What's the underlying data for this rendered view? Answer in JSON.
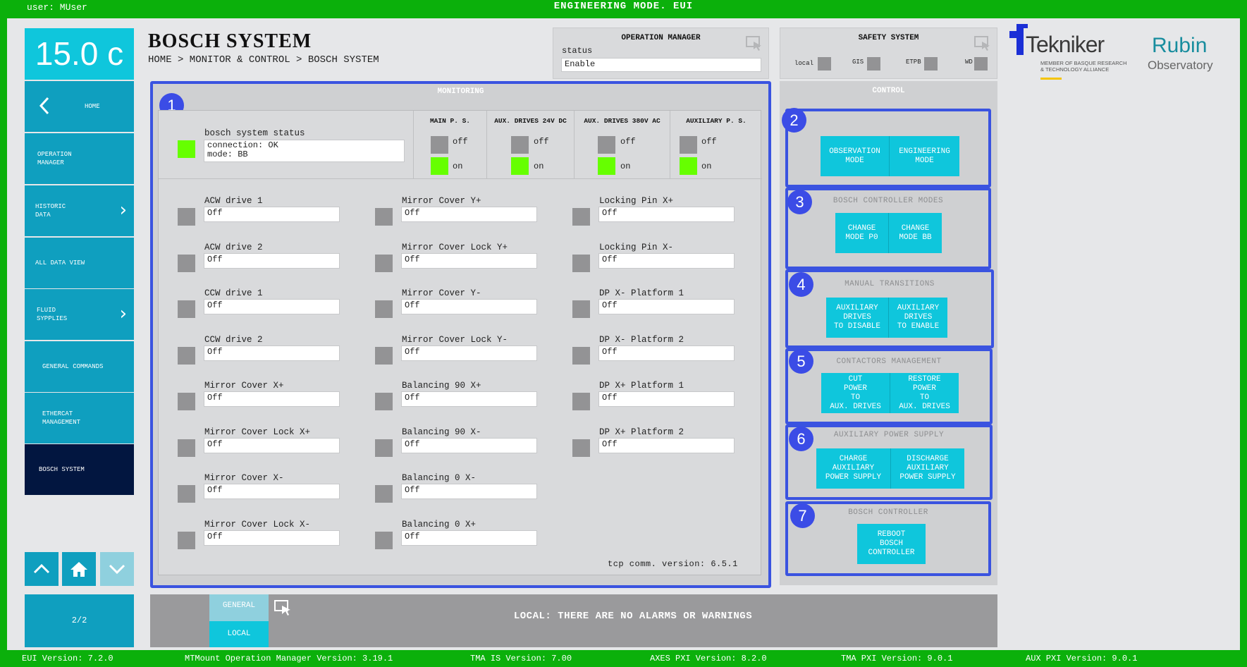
{
  "topbar": {
    "user": "user: MUser",
    "mode": "ENGINEERING MODE. EUI"
  },
  "temperature": "15.0 c",
  "nav": {
    "home": "HOME",
    "operation_manager": "OPERATION\nMANAGER",
    "historic_data": "HISTORIC\nDATA",
    "all_data_view": "ALL DATA VIEW",
    "fluid_supplies": "FLUID\nSYPPLIES",
    "general_commands": "GENERAL COMMANDS",
    "ethercat": "ETHERCAT\nMANAGEMENT",
    "bosch_system": "BOSCH SYSTEM",
    "page": "2/2"
  },
  "header": {
    "title": "BOSCH SYSTEM",
    "breadcrumb": "HOME > MONITOR & CONTROL > BOSCH SYSTEM"
  },
  "operation_manager": {
    "title": "OPERATION MANAGER",
    "status_label": "status",
    "status_value": "Enable"
  },
  "safety": {
    "title": "SAFETY SYSTEM",
    "items": [
      "local",
      "GIS",
      "ETPB",
      "WD"
    ]
  },
  "monitoring": {
    "title": "MONITORING",
    "badge": "1",
    "status_label": "bosch system status",
    "connection": "connection: OK",
    "mode": "mode: BB",
    "power": [
      {
        "title": "MAIN P. S.",
        "off": "off",
        "on": "on"
      },
      {
        "title": "AUX. DRIVES 24V DC",
        "off": "off",
        "on": "on"
      },
      {
        "title": "AUX. DRIVES 380V AC",
        "off": "off",
        "on": "on"
      },
      {
        "title": "AUXILIARY P. S.",
        "off": "off",
        "on": "on"
      }
    ],
    "col1": [
      {
        "label": "ACW drive 1",
        "value": "Off"
      },
      {
        "label": "ACW drive 2",
        "value": "Off"
      },
      {
        "label": "CCW drive 1",
        "value": "Off"
      },
      {
        "label": "CCW drive 2",
        "value": "Off"
      },
      {
        "label": "Mirror Cover X+",
        "value": "Off"
      },
      {
        "label": "Mirror Cover Lock X+",
        "value": "Off"
      },
      {
        "label": "Mirror Cover X-",
        "value": "Off"
      },
      {
        "label": "Mirror Cover Lock X-",
        "value": "Off"
      }
    ],
    "col2": [
      {
        "label": "Mirror Cover Y+",
        "value": "Off"
      },
      {
        "label": "Mirror Cover Lock Y+",
        "value": "Off"
      },
      {
        "label": "Mirror Cover Y-",
        "value": "Off"
      },
      {
        "label": "Mirror Cover Lock Y-",
        "value": "Off"
      },
      {
        "label": "Balancing 90 X+",
        "value": "Off"
      },
      {
        "label": "Balancing 90 X-",
        "value": "Off"
      },
      {
        "label": "Balancing 0 X-",
        "value": "Off"
      },
      {
        "label": "Balancing 0 X+",
        "value": "Off"
      }
    ],
    "col3": [
      {
        "label": "Locking Pin X+",
        "value": "Off"
      },
      {
        "label": "Locking Pin X-",
        "value": "Off"
      },
      {
        "label": "DP X- Platform 1",
        "value": "Off"
      },
      {
        "label": "DP X- Platform 2",
        "value": "Off"
      },
      {
        "label": "DP X+ Platform 1",
        "value": "Off"
      },
      {
        "label": "DP X+ Platform 2",
        "value": "Off"
      }
    ],
    "tcp_version": "tcp comm. version: 6.5.1"
  },
  "control": {
    "title": "CONTROL",
    "sections": [
      {
        "badge": "2",
        "heading": "",
        "buttons": [
          "OBSERVATION\nMODE",
          "ENGINEERING\nMODE"
        ]
      },
      {
        "badge": "3",
        "heading": "BOSCH CONTROLLER MODES",
        "buttons": [
          "CHANGE\nMODE P0",
          "CHANGE\nMODE BB"
        ]
      },
      {
        "badge": "4",
        "heading": "MANUAL TRANSITIONS",
        "buttons": [
          "AUXILIARY\nDRIVES\nTO DISABLE",
          "AUXILIARY\nDRIVES\nTO ENABLE"
        ]
      },
      {
        "badge": "5",
        "heading": "CONTACTORS MANAGEMENT",
        "buttons": [
          "CUT\nPOWER\nTO\nAUX. DRIVES",
          "RESTORE\nPOWER\nTO\nAUX. DRIVES"
        ]
      },
      {
        "badge": "6",
        "heading": "AUXILIARY POWER SUPPLY",
        "buttons": [
          "CHARGE\nAUXILIARY\nPOWER SUPPLY",
          "DISCHARGE\nAUXILIARY\nPOWER SUPPLY"
        ]
      },
      {
        "badge": "7",
        "heading": "BOSCH CONTROLLER",
        "buttons": [
          "REBOOT\nBOSCH\nCONTROLLER"
        ]
      }
    ]
  },
  "logos": {
    "tekniker": "Tekniker",
    "tekniker_sub": "MEMBER OF BASQUE RESEARCH\n& TECHNOLOGY ALLIANCE",
    "rubin": "Rubin",
    "observatory": "Observatory"
  },
  "alarms": {
    "tab_general": "GENERAL",
    "tab_local": "LOCAL",
    "message": "LOCAL: THERE ARE NO ALARMS OR WARNINGS"
  },
  "footer": [
    "EUI Version: 7.2.0",
    "MTMount Operation Manager Version: 3.19.1",
    "TMA IS Version: 7.00",
    "AXES PXI Version: 8.2.0",
    "TMA PXI Version: 9.0.1",
    "AUX PXI Version: 9.0.1"
  ],
  "colors": {
    "frame": "#0bb00b",
    "accent": "#0fc6dc",
    "nav": "#0f9fbf",
    "nav_active": "#021640",
    "highlight": "#3a53e0",
    "on": "#66ff00",
    "off": "#939395"
  }
}
